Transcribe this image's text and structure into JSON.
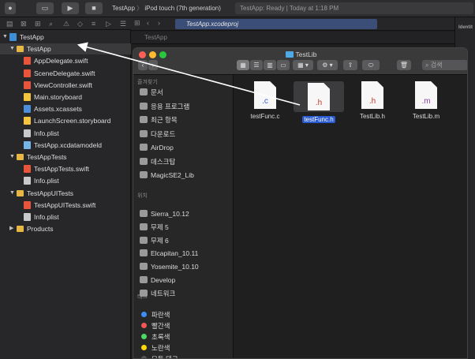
{
  "toolbar": {
    "scheme": "TestApp",
    "device": "iPod touch (7th generation)",
    "status": "TestApp: Ready | Today at 1:18 PM"
  },
  "navigator": {
    "items": [
      {
        "label": "TestApp",
        "kind": "proj",
        "disclosure": "down",
        "level": 0
      },
      {
        "label": "TestApp",
        "kind": "folder",
        "disclosure": "down",
        "level": 1,
        "selected": true
      },
      {
        "label": "AppDelegate.swift",
        "kind": "swift",
        "level": 2
      },
      {
        "label": "SceneDelegate.swift",
        "kind": "swift",
        "level": 2
      },
      {
        "label": "ViewController.swift",
        "kind": "swift",
        "level": 2
      },
      {
        "label": "Main.storyboard",
        "kind": "sb",
        "level": 2
      },
      {
        "label": "Assets.xcassets",
        "kind": "assets",
        "level": 2
      },
      {
        "label": "LaunchScreen.storyboard",
        "kind": "sb",
        "level": 2
      },
      {
        "label": "Info.plist",
        "kind": "plist",
        "level": 2
      },
      {
        "label": "TestApp.xcdatamodeld",
        "kind": "model",
        "level": 2
      },
      {
        "label": "TestAppTests",
        "kind": "folder",
        "disclosure": "down",
        "level": 1
      },
      {
        "label": "TestAppTests.swift",
        "kind": "swift",
        "level": 2
      },
      {
        "label": "Info.plist",
        "kind": "plist",
        "level": 2
      },
      {
        "label": "TestAppUITests",
        "kind": "folder",
        "disclosure": "down",
        "level": 1
      },
      {
        "label": "TestAppUITests.swift",
        "kind": "swift",
        "level": 2
      },
      {
        "label": "Info.plist",
        "kind": "plist",
        "level": 2
      },
      {
        "label": "Products",
        "kind": "folder",
        "disclosure": "right",
        "level": 1
      }
    ]
  },
  "editor": {
    "tab": "TestApp.xcodeproj",
    "breadcrumb": "TestApp"
  },
  "inspector": {
    "title": "Identit"
  },
  "finder": {
    "title": "TestLib",
    "search_placeholder": "검색",
    "favorites_header": "즐겨찾기",
    "favorites": [
      "문서",
      "응용 프로그램",
      "최근 항목",
      "다운로드",
      "AirDrop",
      "데스크탑",
      "MagicSE2_Lib"
    ],
    "locations_header": "위치",
    "locations": [
      "Sierra_10.12",
      "무제 5",
      "무제 6",
      "Elcapitan_10.11",
      "Yosemite_10.10",
      "Develop",
      "네트워크"
    ],
    "tags_header": "태그",
    "tags": [
      {
        "label": "파란색",
        "color": "#3e8ef7"
      },
      {
        "label": "빨간색",
        "color": "#f25656"
      },
      {
        "label": "초록색",
        "color": "#4cd964"
      },
      {
        "label": "노란색",
        "color": "#ffd60a"
      },
      {
        "label": "모든 태그...",
        "color": "#555555"
      }
    ],
    "files": [
      {
        "name": "testFunc.c",
        "ext": ".c",
        "ext_color": "#3b5bdb",
        "selected": false
      },
      {
        "name": "testFunc.h",
        "ext": ".h",
        "ext_color": "#c0392b",
        "selected": true
      },
      {
        "name": "TestLib.h",
        "ext": ".h",
        "ext_color": "#c0392b",
        "selected": false
      },
      {
        "name": "TestLib.m",
        "ext": ".m",
        "ext_color": "#8e44ad",
        "selected": false
      }
    ]
  }
}
